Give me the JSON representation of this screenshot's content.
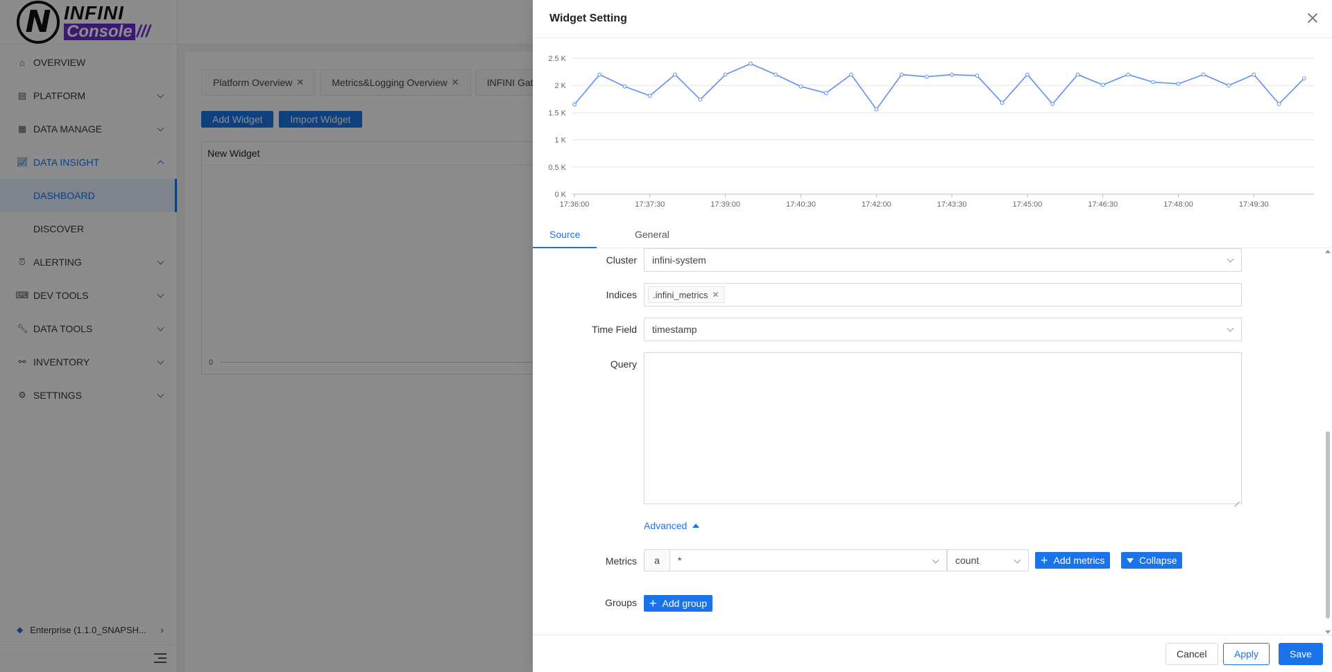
{
  "logo": {
    "mark": "N",
    "top": "INFINI",
    "bottom": "Console",
    "slashes": "///"
  },
  "sidebar": {
    "items": [
      {
        "label": "OVERVIEW",
        "icon": "home-icon"
      },
      {
        "label": "PLATFORM",
        "icon": "platform-icon"
      },
      {
        "label": "DATA MANAGE",
        "icon": "database-icon"
      },
      {
        "label": "DATA INSIGHT",
        "icon": "chart-icon"
      },
      {
        "label": "DASHBOARD"
      },
      {
        "label": "DISCOVER"
      },
      {
        "label": "ALERTING",
        "icon": "alarm-icon"
      },
      {
        "label": "DEV TOOLS",
        "icon": "code-icon"
      },
      {
        "label": "DATA TOOLS",
        "icon": "wrench-icon"
      },
      {
        "label": "INVENTORY",
        "icon": "share-icon"
      },
      {
        "label": "SETTINGS",
        "icon": "gear-icon"
      }
    ],
    "footer": {
      "label": "Enterprise (1.1.0_SNAPSH...",
      "icon": "gem-icon"
    }
  },
  "main": {
    "tabs": [
      {
        "label": "Platform Overview"
      },
      {
        "label": "Metrics&Logging Overview"
      },
      {
        "label": "INFINI Gatew"
      }
    ],
    "add_widget": "Add Widget",
    "import_widget": "Import Widget",
    "widget_title": "New Widget",
    "widget_zero": "0"
  },
  "drawer": {
    "title": "Widget Setting",
    "tabs": {
      "source": "Source",
      "general": "General"
    },
    "form": {
      "cluster_label": "Cluster",
      "cluster_value": "infini-system",
      "indices_label": "Indices",
      "indices_tag": ".infini_metrics",
      "timefield_label": "Time Field",
      "timefield_value": "timestamp",
      "query_label": "Query",
      "advanced": "Advanced",
      "metrics_label": "Metrics",
      "metrics_prefix": "a",
      "metrics_field": "*",
      "metrics_agg": "count",
      "add_metrics": "Add metrics",
      "collapse": "Collapse",
      "groups_label": "Groups",
      "add_group": "Add group"
    },
    "footer": {
      "cancel": "Cancel",
      "apply": "Apply",
      "save": "Save"
    }
  },
  "colors": {
    "accent": "#1a73e8",
    "brand": "#6b2fd6",
    "line": "#5b8ff9"
  },
  "chart_data": {
    "type": "line",
    "ylim": [
      0,
      2500
    ],
    "yticks": [
      {
        "v": 0,
        "label": "0 K"
      },
      {
        "v": 500,
        "label": "0.5 K"
      },
      {
        "v": 1000,
        "label": "1 K"
      },
      {
        "v": 1500,
        "label": "1.5 K"
      },
      {
        "v": 2000,
        "label": "2 K"
      },
      {
        "v": 2500,
        "label": "2.5 K"
      }
    ],
    "xticks": [
      "17:36:00",
      "17:37:30",
      "17:39:00",
      "17:40:30",
      "17:42:00",
      "17:43:30",
      "17:45:00",
      "17:46:30",
      "17:48:00",
      "17:49:30"
    ],
    "series": [
      {
        "values": [
          1650,
          2200,
          1980,
          1810,
          2200,
          1740,
          2200,
          2400,
          2200,
          1980,
          1860,
          2200,
          1560,
          2200,
          2160,
          2200,
          2180,
          1680,
          2200,
          1660,
          2200,
          2010,
          2200,
          2060,
          2030,
          2200,
          2000,
          2200,
          1660,
          2130
        ]
      }
    ]
  }
}
